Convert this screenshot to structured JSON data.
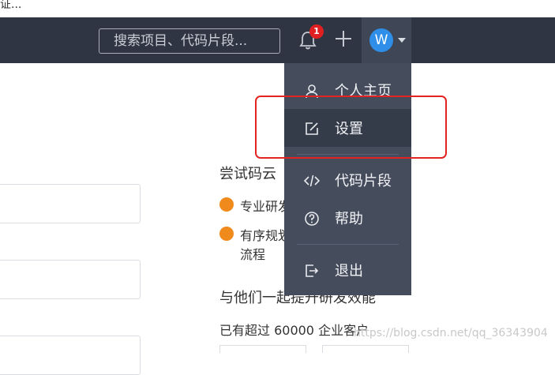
{
  "top_strip": {
    "text": "证..."
  },
  "navbar": {
    "search_placeholder": "搜索项目、代码片段...",
    "notification_count": "1",
    "avatar_letter": "W"
  },
  "menu": {
    "items": [
      {
        "label": "个人主页",
        "icon": "user-icon"
      },
      {
        "label": "设置",
        "icon": "edit-icon",
        "active": true
      },
      {
        "label": "代码片段",
        "icon": "code-icon"
      },
      {
        "label": "帮助",
        "icon": "help-icon"
      },
      {
        "label": "退出",
        "icon": "logout-icon"
      }
    ]
  },
  "content": {
    "try_title": "尝试码云",
    "bullet1": "专业研发",
    "bullet2_line1": "有序规划",
    "bullet2_line2": "流程",
    "promo2": "与他们一起提升研发效能",
    "customers": "已有超过 60000 企业客户",
    "watermark": "https://blog.csdn.net/qq_36343904"
  },
  "colors": {
    "navbar": "#2f3542",
    "menu": "#454c5c",
    "accent": "#2f8ee8",
    "badge": "#e02020",
    "highlight_box": "#e42323",
    "bullet": "#f08a1c"
  }
}
